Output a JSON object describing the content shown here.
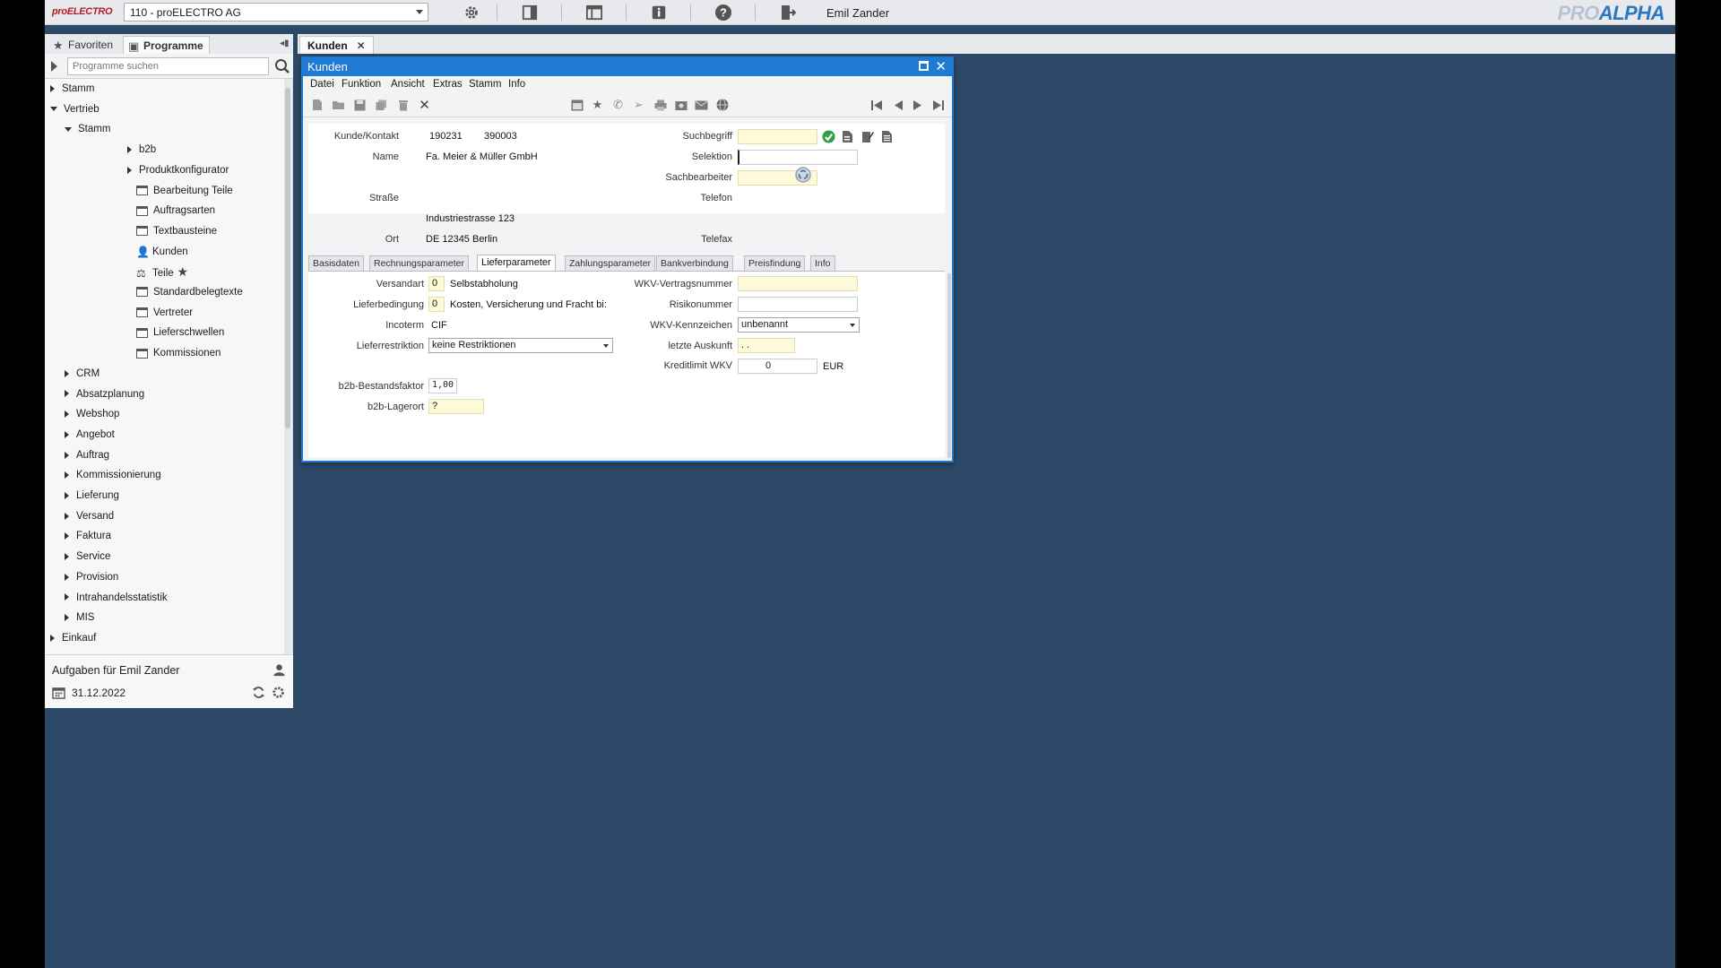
{
  "topbar": {
    "brand_left": "proELECTRO",
    "company": "110 - proELECTRO AG",
    "username": "Emil Zander",
    "brand_right_a": "PRO",
    "brand_right_b": "ALPHA"
  },
  "nav_tabs": [
    {
      "label": "Favoriten",
      "icon": "star-icon"
    },
    {
      "label": "Programme",
      "icon": "programs-icon"
    }
  ],
  "doc_tab": {
    "label": "Kunden"
  },
  "search": {
    "placeholder": "Programme suchen"
  },
  "tree": [
    {
      "label": "Stamm",
      "level": 0,
      "state": "closed"
    },
    {
      "label": "Vertrieb",
      "level": 0,
      "state": "open"
    },
    {
      "label": "Stamm",
      "level": 1,
      "state": "open"
    },
    {
      "label": "b2b",
      "level": 2,
      "state": "closed"
    },
    {
      "label": "Produktkonfigurator",
      "level": 2,
      "state": "closed"
    },
    {
      "label": "Bearbeitung Teile",
      "level": 2,
      "state": "leaf"
    },
    {
      "label": "Auftragsarten",
      "level": 2,
      "state": "leaf"
    },
    {
      "label": "Textbausteine",
      "level": 2,
      "state": "leaf"
    },
    {
      "label": "Kunden",
      "level": 2,
      "state": "leaf-person"
    },
    {
      "label": "Teile",
      "level": 2,
      "state": "leaf-star"
    },
    {
      "label": "Standardbelegtexte",
      "level": 2,
      "state": "leaf"
    },
    {
      "label": "Vertreter",
      "level": 2,
      "state": "leaf"
    },
    {
      "label": "Lieferschwellen",
      "level": 2,
      "state": "leaf"
    },
    {
      "label": "Kommissionen",
      "level": 2,
      "state": "leaf"
    },
    {
      "label": "CRM",
      "level": 1,
      "state": "closed"
    },
    {
      "label": "Absatzplanung",
      "level": 1,
      "state": "closed"
    },
    {
      "label": "Webshop",
      "level": 1,
      "state": "closed"
    },
    {
      "label": "Angebot",
      "level": 1,
      "state": "closed"
    },
    {
      "label": "Auftrag",
      "level": 1,
      "state": "closed"
    },
    {
      "label": "Kommissionierung",
      "level": 1,
      "state": "closed"
    },
    {
      "label": "Lieferung",
      "level": 1,
      "state": "closed"
    },
    {
      "label": "Versand",
      "level": 1,
      "state": "closed"
    },
    {
      "label": "Faktura",
      "level": 1,
      "state": "closed"
    },
    {
      "label": "Service",
      "level": 1,
      "state": "closed"
    },
    {
      "label": "Provision",
      "level": 1,
      "state": "closed"
    },
    {
      "label": "Intrahandelsstatistik",
      "level": 1,
      "state": "closed"
    },
    {
      "label": "MIS",
      "level": 1,
      "state": "closed"
    },
    {
      "label": "Einkauf",
      "level": 0,
      "state": "closed"
    }
  ],
  "tasks": {
    "title": "Aufgaben für Emil Zander",
    "date": "31.12.2022"
  },
  "window": {
    "title": "Kunden",
    "menu": [
      "Datei",
      "Funktion",
      "Ansicht",
      "Extras",
      "Stamm",
      "Info"
    ]
  },
  "header": {
    "kunde_label": "Kunde/Kontakt",
    "kunde_nr": "190231",
    "kontakt_nr": "390003",
    "name_label": "Name",
    "name": "Fa. Meier & Müller GmbH",
    "strasse_label": "Straße",
    "strasse": "Industriestrasse 123",
    "ort_label": "Ort",
    "ort": "DE 12345 Berlin",
    "suchbegriff_label": "Suchbegriff",
    "suchbegriff": "",
    "selektion_label": "Selektion",
    "selektion": "",
    "sachbearbeiter_label": "Sachbearbeiter",
    "sachbearbeiter": "",
    "telefon_label": "Telefon",
    "telefax_label": "Telefax"
  },
  "tabs": [
    "Basisdaten",
    "Rechnungsparameter",
    "Lieferparameter",
    "Zahlungsparameter",
    "Bankverbindung",
    "Preisfindung",
    "Info"
  ],
  "active_tab": "Lieferparameter",
  "liefer": {
    "versandart_label": "Versandart",
    "versandart_code": "0",
    "versandart_text": "Selbstabholung",
    "lieferbedingung_label": "Lieferbedingung",
    "lieferbedingung_code": "0",
    "lieferbedingung_text": "Kosten, Versicherung und Fracht bi:",
    "incoterm_label": "Incoterm",
    "incoterm": "CIF",
    "lieferrestriktion_label": "Lieferrestriktion",
    "lieferrestriktion": "keine Restriktionen",
    "bestandsfaktor_label": "b2b-Bestandsfaktor",
    "bestandsfaktor": "1,00",
    "lagerort_label": "b2b-Lagerort",
    "lagerort": "?",
    "wkv_vertrag_label": "WKV-Vertragsnummer",
    "wkv_vertrag": "",
    "risikonummer_label": "Risikonummer",
    "risikonummer": "",
    "wkv_kennzeichen_label": "WKV-Kennzeichen",
    "wkv_kennzeichen": "unbenannt",
    "letzte_auskunft_label": "letzte Auskunft",
    "letzte_auskunft": ". .",
    "kreditlimit_label": "Kreditlimit WKV",
    "kreditlimit": "0",
    "currency": "EUR"
  }
}
